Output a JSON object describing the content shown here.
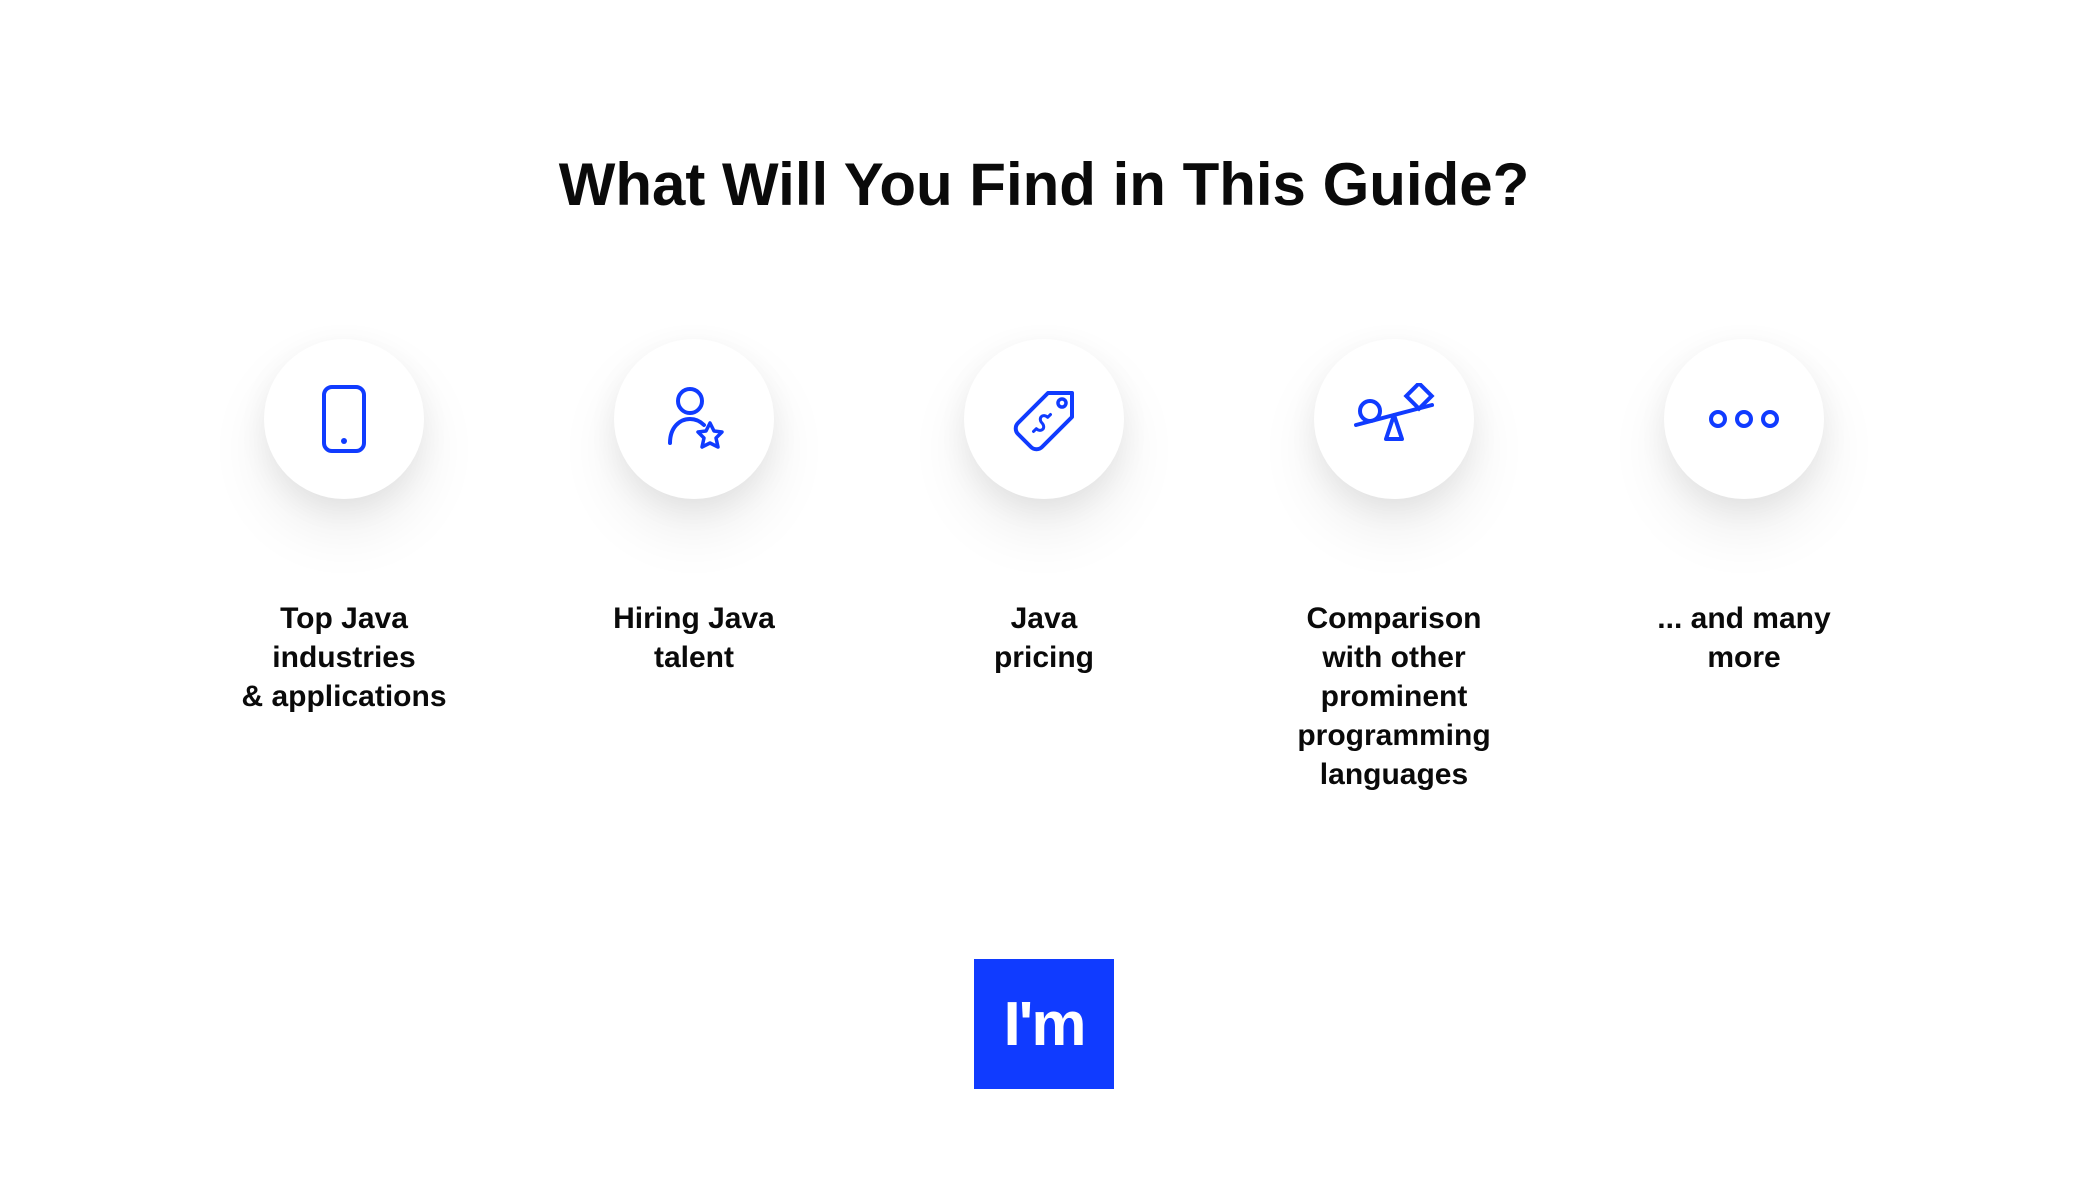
{
  "title": "What Will You Find in This Guide?",
  "logo": "I'm",
  "items": [
    {
      "label": "Top Java\nindustries\n& applications"
    },
    {
      "label": "Hiring Java\ntalent"
    },
    {
      "label": "Java\npricing"
    },
    {
      "label": "Comparison\nwith other\nprominent\nprogramming\nlanguages"
    },
    {
      "label": "... and many\nmore"
    }
  ],
  "colors": {
    "accent": "#103BFF"
  }
}
